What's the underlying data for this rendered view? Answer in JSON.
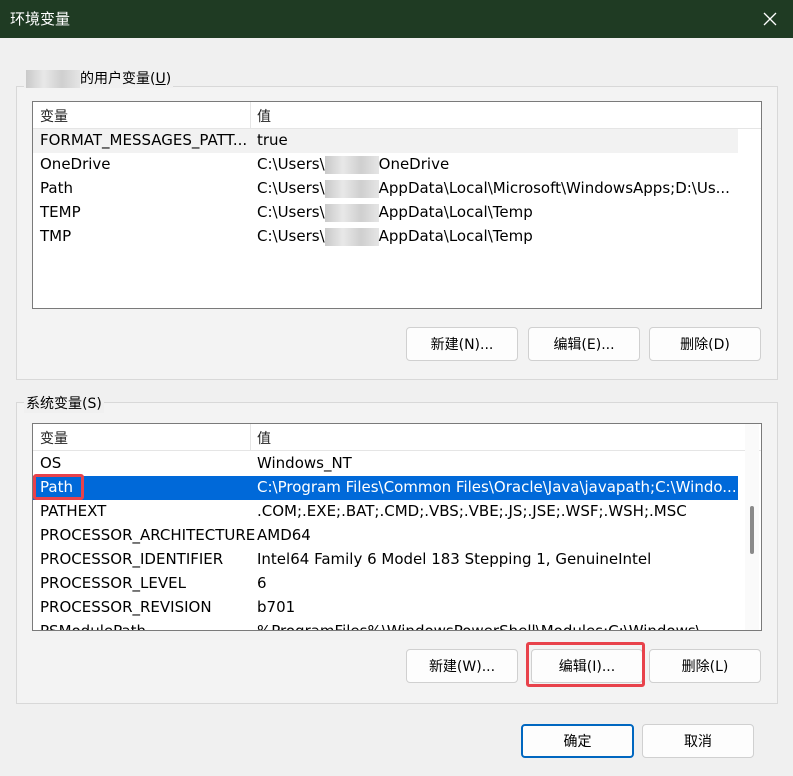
{
  "window": {
    "title": "环境变量"
  },
  "user_vars": {
    "label_suffix": "的用户变量",
    "shortcut": "U",
    "columns": [
      "变量",
      "值"
    ],
    "rows": [
      {
        "name": "FORMAT_MESSAGES_PATT...",
        "value_pre": "true",
        "value_post": ""
      },
      {
        "name": "OneDrive",
        "value_pre": "C:\\Users\\",
        "value_post": "OneDrive"
      },
      {
        "name": "Path",
        "value_pre": "C:\\Users\\",
        "value_post": "AppData\\Local\\Microsoft\\WindowsApps;D:\\Us..."
      },
      {
        "name": "TEMP",
        "value_pre": "C:\\Users\\",
        "value_post": "AppData\\Local\\Temp"
      },
      {
        "name": "TMP",
        "value_pre": "C:\\Users\\",
        "value_post": "AppData\\Local\\Temp"
      }
    ],
    "buttons": {
      "new": "新建(N)...",
      "edit": "编辑(E)...",
      "delete": "删除(D)"
    }
  },
  "system_vars": {
    "label": "系统变量(S)",
    "columns": [
      "变量",
      "值"
    ],
    "rows": [
      {
        "name": "OS",
        "value": "Windows_NT"
      },
      {
        "name": "Path",
        "value": "C:\\Program Files\\Common Files\\Oracle\\Java\\javapath;C:\\Windo..."
      },
      {
        "name": "PATHEXT",
        "value": ".COM;.EXE;.BAT;.CMD;.VBS;.VBE;.JS;.JSE;.WSF;.WSH;.MSC"
      },
      {
        "name": "PROCESSOR_ARCHITECTURE",
        "value": "AMD64"
      },
      {
        "name": "PROCESSOR_IDENTIFIER",
        "value": "Intel64 Family 6 Model 183 Stepping 1, GenuineIntel"
      },
      {
        "name": "PROCESSOR_LEVEL",
        "value": "6"
      },
      {
        "name": "PROCESSOR_REVISION",
        "value": "b701"
      },
      {
        "name": "PSModulePath",
        "value": "%ProgramFiles%\\WindowsPowerShell\\Modules;C:\\Windows\\..."
      }
    ],
    "selected_row": "Path",
    "buttons": {
      "new": "新建(W)...",
      "edit": "编辑(I)...",
      "delete": "删除(L)"
    }
  },
  "footer": {
    "ok": "确定",
    "cancel": "取消"
  },
  "colors": {
    "titlebar": "#1f3b23",
    "selection": "#0069d9",
    "highlight": "#e8424b",
    "primary_border": "#0067c0"
  },
  "icons": {
    "close": "close-icon"
  }
}
